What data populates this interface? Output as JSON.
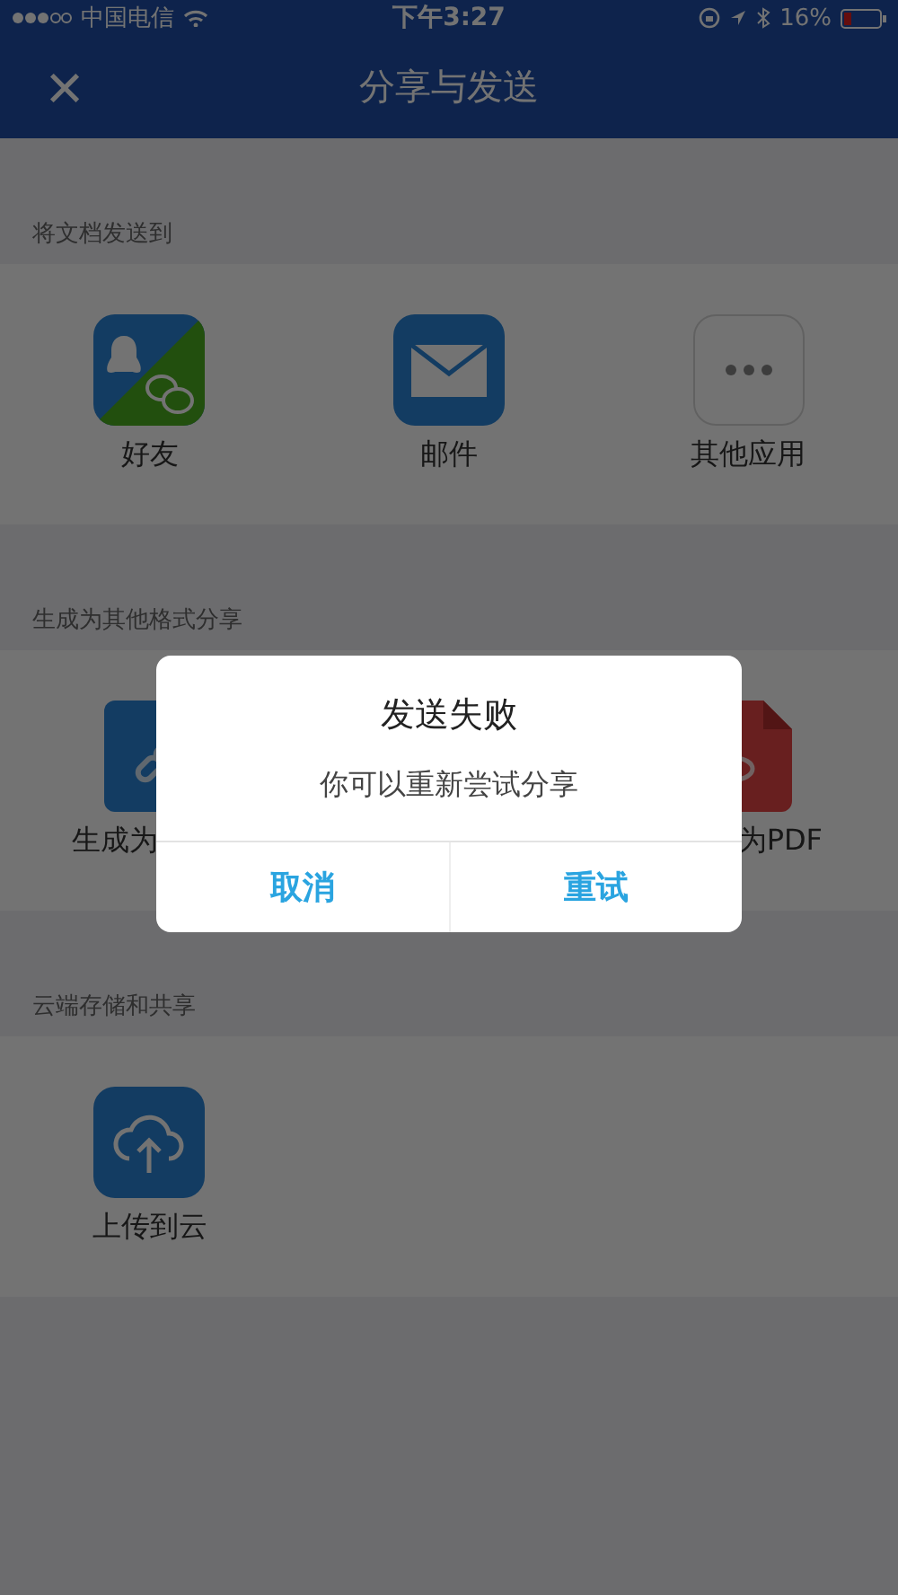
{
  "status_bar": {
    "carrier": "中国电信",
    "time": "下午3:27",
    "battery": "16%"
  },
  "nav": {
    "close": "×",
    "title": "分享与发送"
  },
  "sections": [
    {
      "header": "将文档发送到",
      "items": [
        {
          "kind": "chat",
          "label": "好友"
        },
        {
          "kind": "mail",
          "label": "邮件"
        },
        {
          "kind": "more",
          "label": "其他应用"
        }
      ]
    },
    {
      "header": "生成为其他格式分享",
      "sparse": true,
      "items": [
        {
          "kind": "link",
          "label": "生成为"
        },
        {
          "kind": "pdf",
          "label": "为PDF"
        }
      ]
    },
    {
      "header": "云端存储和共享",
      "items": [
        {
          "kind": "cloud",
          "label": "上传到云"
        }
      ]
    }
  ],
  "dialog": {
    "title": "发送失败",
    "message": "你可以重新尝试分享",
    "buttons": [
      "取消",
      "重试"
    ]
  }
}
